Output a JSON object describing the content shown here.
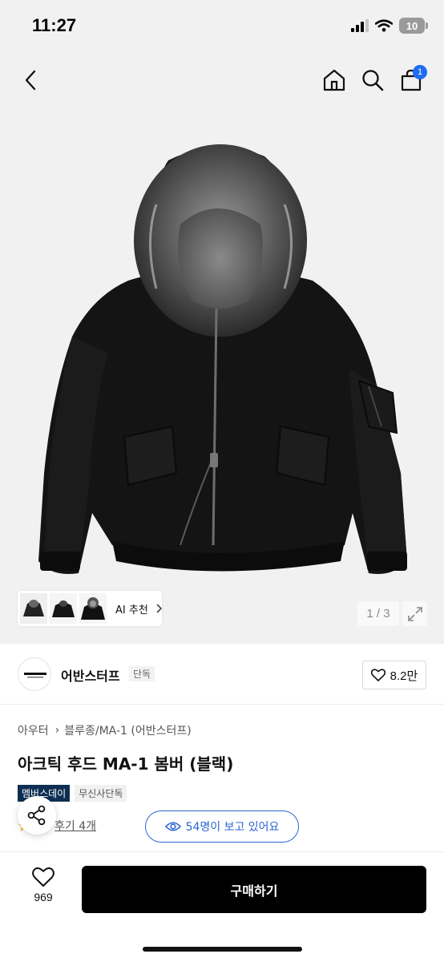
{
  "status_bar": {
    "time": "11:27",
    "battery": "10"
  },
  "nav": {
    "cart_count": "1",
    "icons": [
      "back-arrow-icon",
      "home-icon",
      "search-icon",
      "cart-icon"
    ]
  },
  "gallery": {
    "ai_recommend_label": "AI 추천",
    "page_counter": "1 / 3"
  },
  "brand": {
    "name": "어반스터프",
    "tag": "단독",
    "likes": "8.2만"
  },
  "product": {
    "breadcrumb": [
      "아우터",
      "블루종/MA-1 (어반스터프)"
    ],
    "title": "아크틱 후드 MA-1 봄버 (블랙)",
    "badges": [
      "멤버스데이",
      "무신사단독"
    ],
    "review_link": "후기 4개",
    "viewers_text": "54명이 보고 있어요"
  },
  "bottom_bar": {
    "wish_count": "969",
    "buy_label": "구매하기"
  },
  "colors": {
    "accent_blue": "#2c66d3",
    "badge_navy": "#0e2f52",
    "cart_badge": "#1e6cf0",
    "buy_button": "#000000"
  }
}
